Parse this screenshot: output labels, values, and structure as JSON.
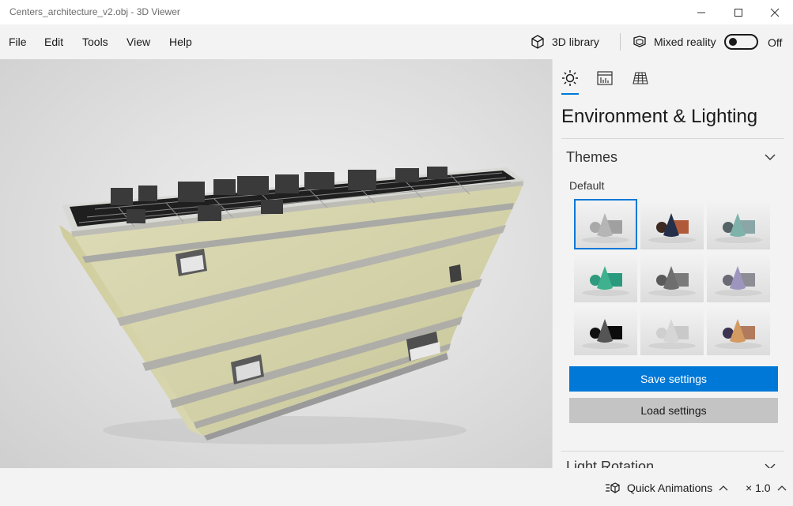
{
  "window": {
    "title": "Centers_architecture_v2.obj - 3D Viewer"
  },
  "menu": {
    "items": [
      "File",
      "Edit",
      "Tools",
      "View",
      "Help"
    ]
  },
  "toolbar": {
    "library_label": "3D library",
    "mixed_reality_label": "Mixed reality",
    "toggle_state": "Off"
  },
  "panel": {
    "title": "Environment & Lighting",
    "themes_heading": "Themes",
    "default_label": "Default",
    "themes": [
      {
        "name": "default",
        "sphere": "#a9a9a9",
        "cone": "#b5b5b5",
        "cube": "#a0a0a0"
      },
      {
        "name": "dark-orange",
        "sphere": "#3d2a22",
        "cone": "#24304a",
        "cube": "#b05a3a"
      },
      {
        "name": "teal-gray",
        "sphere": "#556266",
        "cone": "#7fb2aa",
        "cube": "#8aa6a6"
      },
      {
        "name": "green",
        "sphere": "#2f9a7e",
        "cone": "#3fb18f",
        "cube": "#2a9a7f"
      },
      {
        "name": "dark-gray",
        "sphere": "#5a5a5a",
        "cone": "#6e6e6e",
        "cube": "#7a7a7a"
      },
      {
        "name": "lavender",
        "sphere": "#6a6a76",
        "cone": "#9e95bf",
        "cube": "#8d8d96"
      },
      {
        "name": "black",
        "sphere": "#111111",
        "cone": "#555555",
        "cube": "#0c0c0c"
      },
      {
        "name": "light",
        "sphere": "#cfcfcf",
        "cone": "#d6d6d6",
        "cube": "#c9c9c9"
      },
      {
        "name": "copper",
        "sphere": "#3c3350",
        "cone": "#d39a62",
        "cube": "#b17a5c"
      }
    ],
    "save_label": "Save settings",
    "load_label": "Load settings",
    "light_rotation_heading": "Light Rotation"
  },
  "status": {
    "animations_label": "Quick Animations",
    "speed": "× 1.0"
  },
  "colors": {
    "accent": "#0078d7",
    "model_wall": "#d6d4ad",
    "model_roof": "#2a2a2a"
  }
}
